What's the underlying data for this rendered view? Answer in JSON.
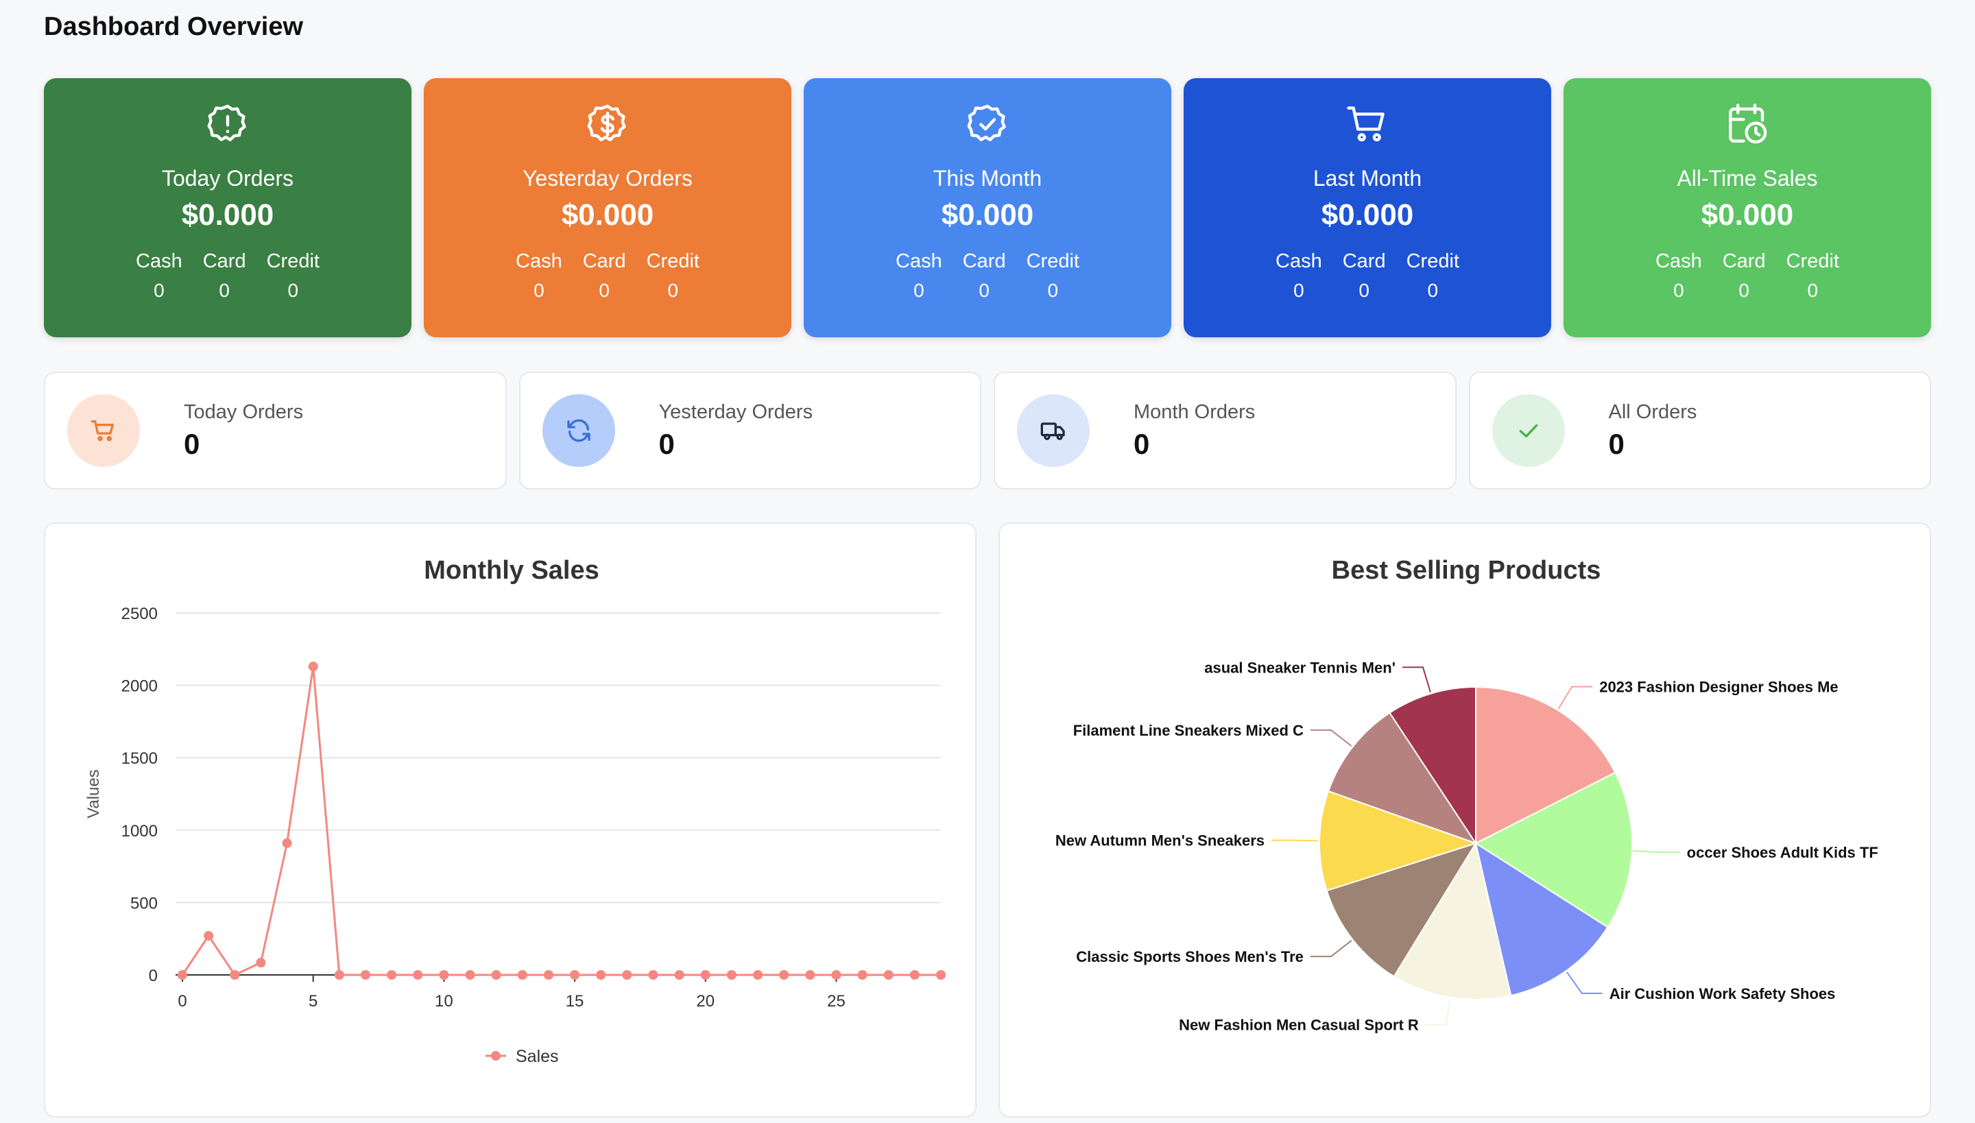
{
  "page_title": "Dashboard Overview",
  "stat_cards": [
    {
      "title": "Today Orders",
      "amount": "$0.000",
      "color": "#3a7f43",
      "icon": "alert-badge-icon",
      "cash_label": "Cash",
      "card_label": "Card",
      "credit_label": "Credit",
      "cash": "0",
      "card": "0",
      "credit": "0"
    },
    {
      "title": "Yesterday Orders",
      "amount": "$0.000",
      "color": "#ec7c36",
      "icon": "dollar-badge-icon",
      "cash_label": "Cash",
      "card_label": "Card",
      "credit_label": "Credit",
      "cash": "0",
      "card": "0",
      "credit": "0"
    },
    {
      "title": "This Month",
      "amount": "$0.000",
      "color": "#4887ee",
      "icon": "check-badge-icon",
      "cash_label": "Cash",
      "card_label": "Card",
      "credit_label": "Credit",
      "cash": "0",
      "card": "0",
      "credit": "0"
    },
    {
      "title": "Last Month",
      "amount": "$0.000",
      "color": "#1e54d4",
      "icon": "shopping-cart-icon",
      "cash_label": "Cash",
      "card_label": "Card",
      "credit_label": "Credit",
      "cash": "0",
      "card": "0",
      "credit": "0"
    },
    {
      "title": "All-Time Sales",
      "amount": "$0.000",
      "color": "#5bc463",
      "icon": "calendar-clock-icon",
      "cash_label": "Cash",
      "card_label": "Card",
      "credit_label": "Credit",
      "cash": "0",
      "card": "0",
      "credit": "0"
    }
  ],
  "count_cards": [
    {
      "label": "Today Orders",
      "value": "0",
      "icon": "cart-icon",
      "icon_bg": "#fde3d6",
      "icon_color": "#ec7c36"
    },
    {
      "label": "Yesterday Orders",
      "value": "0",
      "icon": "refresh-icon",
      "icon_bg": "#b4cdfb",
      "icon_color": "#3b6fd8"
    },
    {
      "label": "Month Orders",
      "value": "0",
      "icon": "truck-icon",
      "icon_bg": "#dbe6fb",
      "icon_color": "#1f2937"
    },
    {
      "label": "All Orders",
      "value": "0",
      "icon": "check-icon",
      "icon_bg": "#e0f3e2",
      "icon_color": "#4caf50"
    }
  ],
  "chart_data": [
    {
      "type": "line",
      "title": "Monthly Sales",
      "xlabel": "",
      "ylabel": "Values",
      "x": [
        0,
        1,
        2,
        3,
        4,
        5,
        6,
        7,
        8,
        9,
        10,
        11,
        12,
        13,
        14,
        15,
        16,
        17,
        18,
        19,
        20,
        21,
        22,
        23,
        24,
        25,
        26,
        27,
        28,
        29
      ],
      "series": [
        {
          "name": "Sales",
          "color": "#f4877f",
          "values": [
            0,
            270,
            0,
            85,
            910,
            2130,
            0,
            0,
            0,
            0,
            0,
            0,
            0,
            0,
            0,
            0,
            0,
            0,
            0,
            0,
            0,
            0,
            0,
            0,
            0,
            0,
            0,
            0,
            0,
            0
          ]
        }
      ],
      "xticks": [
        "0",
        "5",
        "10",
        "15",
        "20",
        "25"
      ],
      "yticks": [
        "0",
        "500",
        "1000",
        "1500",
        "2000",
        "2500"
      ],
      "xlim": [
        0,
        29
      ],
      "ylim": [
        0,
        2500
      ],
      "grid": true,
      "legend": "bottom"
    },
    {
      "type": "pie",
      "title": "Best Selling Products",
      "slices": [
        {
          "label": "2023 Fashion Designer Shoes Me",
          "value": 17,
          "color": "#f6a19a"
        },
        {
          "label": "occer Shoes Adult Kids TF",
          "value": 16,
          "color": "#b2fb9c"
        },
        {
          "label": "Air Cushion Work Safety Shoes",
          "value": 12,
          "color": "#7b8ff7"
        },
        {
          "label": "New Fashion Men Casual Sport R",
          "value": 12,
          "color": "#f6f4e1"
        },
        {
          "label": "Classic Sports Shoes Men's Tre",
          "value": 11,
          "color": "#9c8373"
        },
        {
          "label": "New Autumn Men's Sneakers",
          "value": 10,
          "color": "#fbda4e"
        },
        {
          "label": "Filament Line Sneakers Mixed C",
          "value": 10,
          "color": "#b6827f"
        },
        {
          "label": "asual Sneaker Tennis Men'",
          "value": 9,
          "color": "#a2344f"
        }
      ],
      "legend": "labels"
    }
  ]
}
